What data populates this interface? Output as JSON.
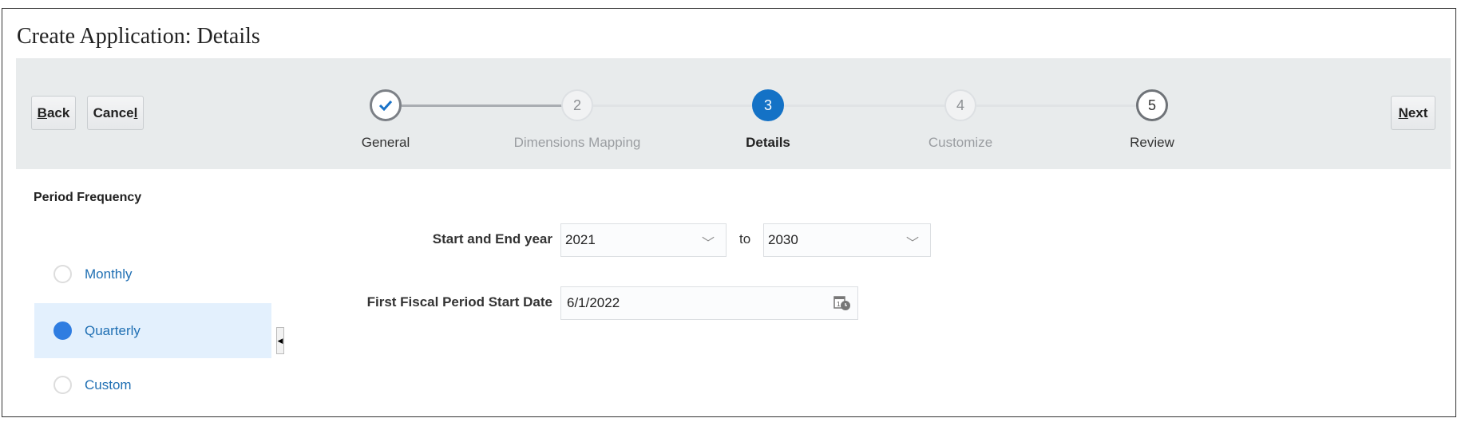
{
  "page_title": "Create Application: Details",
  "toolbar": {
    "back_label": "ack",
    "back_mnemonic": "B",
    "cancel_label": "Cance",
    "cancel_mnemonic": "l",
    "next_label": "ext",
    "next_mnemonic": "N"
  },
  "steps": [
    {
      "number": "1",
      "label": "General",
      "state": "completed"
    },
    {
      "number": "2",
      "label": "Dimensions Mapping",
      "state": "inactive"
    },
    {
      "number": "3",
      "label": "Details",
      "state": "current"
    },
    {
      "number": "4",
      "label": "Customize",
      "state": "inactive"
    },
    {
      "number": "5",
      "label": "Review",
      "state": "available"
    }
  ],
  "period_frequency": {
    "heading": "Period Frequency",
    "options": [
      "Monthly",
      "Quarterly",
      "Custom"
    ],
    "selected": "Quarterly"
  },
  "form": {
    "year_label": "Start and End year",
    "start_year": "2021",
    "to_label": "to",
    "end_year": "2030",
    "date_label": "First Fiscal Period Start Date",
    "start_date": "6/1/2022"
  },
  "colors": {
    "accent": "#1472c6",
    "train_bg": "#e8ebec",
    "selected_bg": "#e3f0fd"
  }
}
